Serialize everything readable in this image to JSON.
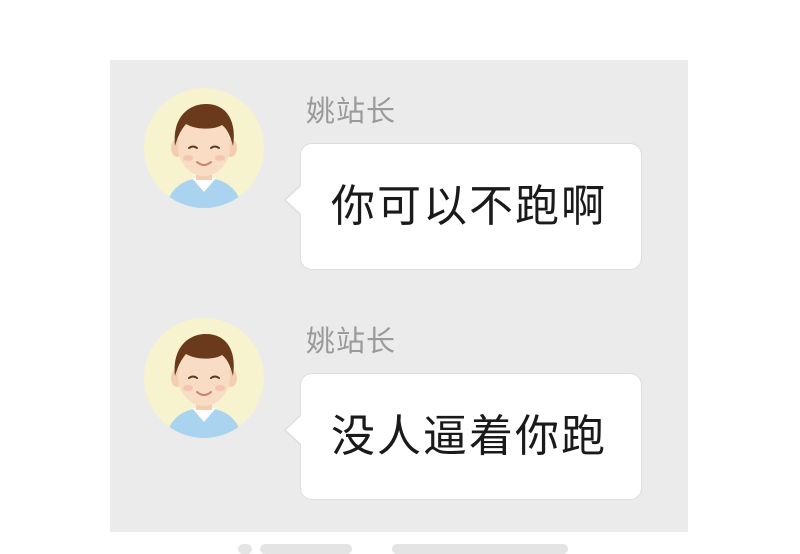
{
  "colors": {
    "chat_background": "#ebebeb",
    "bubble_background": "#ffffff",
    "sender_name": "#9a9a9a",
    "message_text": "#1a1a1a",
    "avatar_background": "#f7f3cf"
  },
  "messages": [
    {
      "sender": "姚站长",
      "avatar_icon": "boy-avatar-icon",
      "text": "你可以不跑啊"
    },
    {
      "sender": "姚站长",
      "avatar_icon": "boy-avatar-icon",
      "text": "没人逼着你跑"
    }
  ]
}
